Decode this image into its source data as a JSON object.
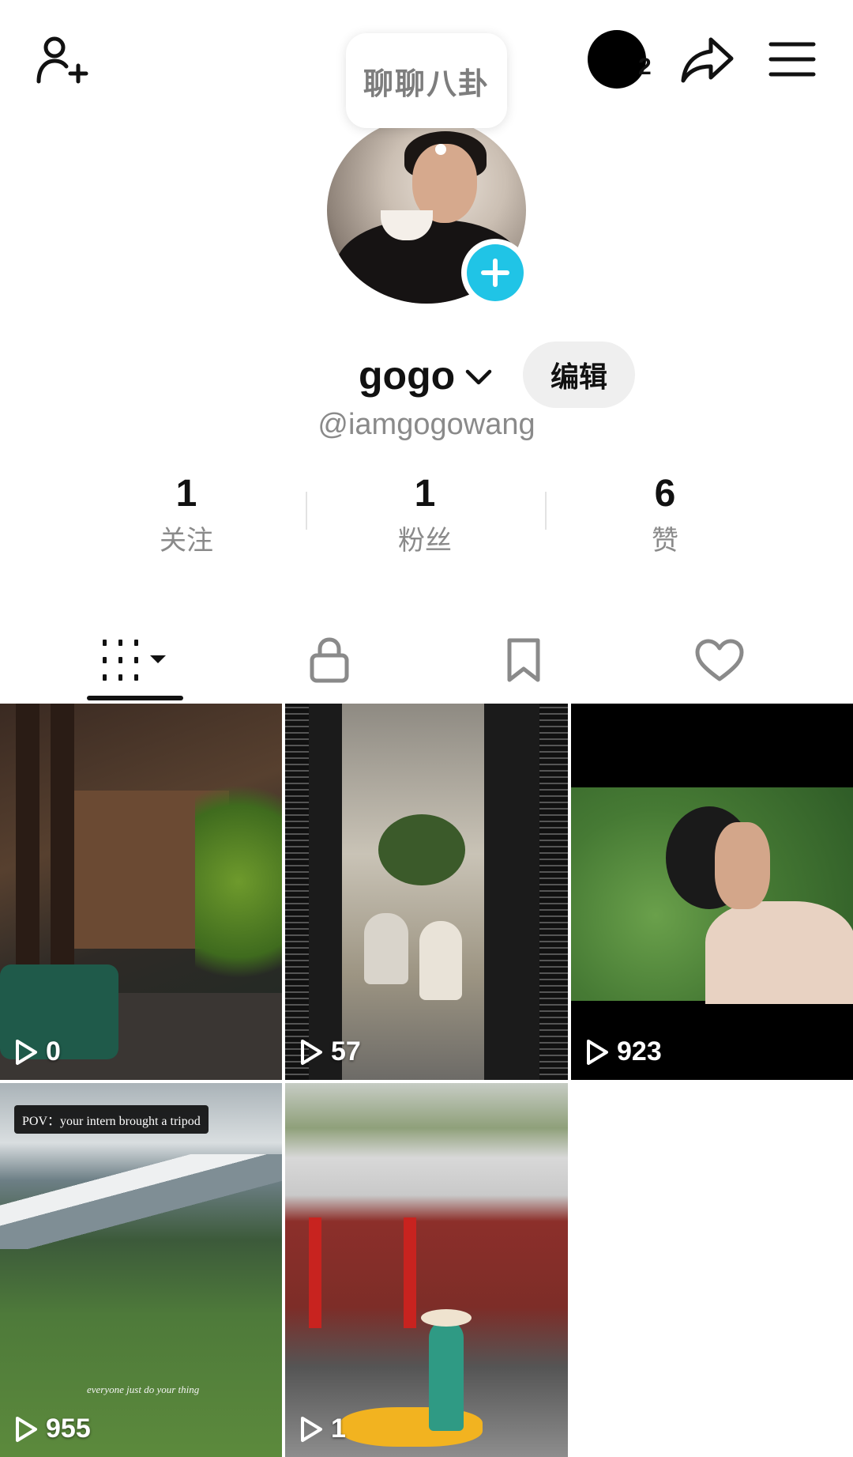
{
  "bubble": {
    "text": "聊聊八卦"
  },
  "top_bar": {
    "story_count": "2"
  },
  "profile": {
    "username": "gogo",
    "edit_label": "编辑",
    "handle": "@iamgogowang"
  },
  "stats": [
    {
      "value": "1",
      "label": "关注"
    },
    {
      "value": "1",
      "label": "粉丝"
    },
    {
      "value": "6",
      "label": "赞"
    }
  ],
  "tabs": {
    "icons": [
      "grid-icon",
      "lock-icon",
      "bookmark-icon",
      "heart-icon"
    ],
    "active_index": 0
  },
  "videos": [
    {
      "views": "0"
    },
    {
      "views": "57"
    },
    {
      "views": "923"
    },
    {
      "views": "955",
      "caption": "POV：your intern brought a tripod",
      "subcaption": "everyone just do your thing"
    },
    {
      "views": "1"
    }
  ],
  "colors": {
    "accent": "#20c4e6",
    "text_primary": "#111111",
    "text_secondary": "#8a8a8a",
    "edit_bg": "#efefef"
  }
}
